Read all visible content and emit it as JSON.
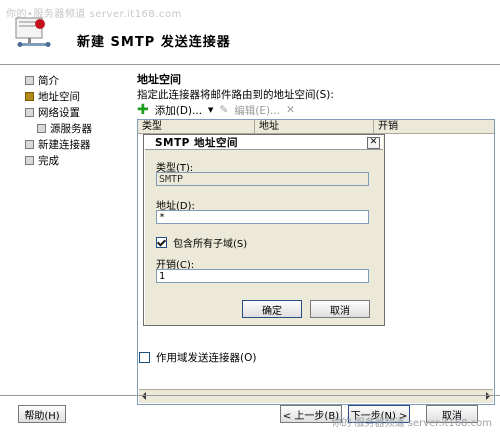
{
  "watermark": "你的•服务器频道 server.it168.com",
  "watermark_bottom": "你的·服务器频道 server.it168.com",
  "wizard": {
    "title": "新建 SMTP 发送连接器",
    "steps": [
      {
        "label": "简介",
        "state": "pending"
      },
      {
        "label": "地址空间",
        "state": "current"
      },
      {
        "label": "网络设置",
        "state": "pending"
      },
      {
        "label": "源服务器",
        "state": "pending"
      },
      {
        "label": "新建连接器",
        "state": "pending"
      },
      {
        "label": "完成",
        "state": "pending"
      }
    ]
  },
  "main": {
    "section_title": "地址空间",
    "instruction": "指定此连接器将邮件路由到的地址空间(S):",
    "toolbar": {
      "add_label": "添加(D)...",
      "edit_label": "编辑(E)...",
      "delete_symbol": "✕"
    },
    "columns": [
      "类型",
      "地址",
      "开销"
    ],
    "scope_checkbox": {
      "label": "作用域发送连接器(O)",
      "checked": false
    }
  },
  "dialog": {
    "title": "SMTP 地址空间",
    "close_symbol": "✕",
    "type_label": "类型(T):",
    "type_value": "SMTP",
    "address_label": "地址(D):",
    "address_value": "*",
    "include_subdomains_label": "包含所有子域(S)",
    "include_subdomains_checked": true,
    "cost_label": "开销(C):",
    "cost_value": "1",
    "ok_label": "确定",
    "cancel_label": "取消"
  },
  "footer": {
    "help_label": "帮助(H)",
    "back_label": "< 上一步(B)",
    "next_label": "下一步(N) >",
    "cancel_label": "取消"
  },
  "colors": {
    "current_step": "#b38a1a",
    "add_icon": "#1e9e1e",
    "dialog_bg": "#ece9d8"
  }
}
